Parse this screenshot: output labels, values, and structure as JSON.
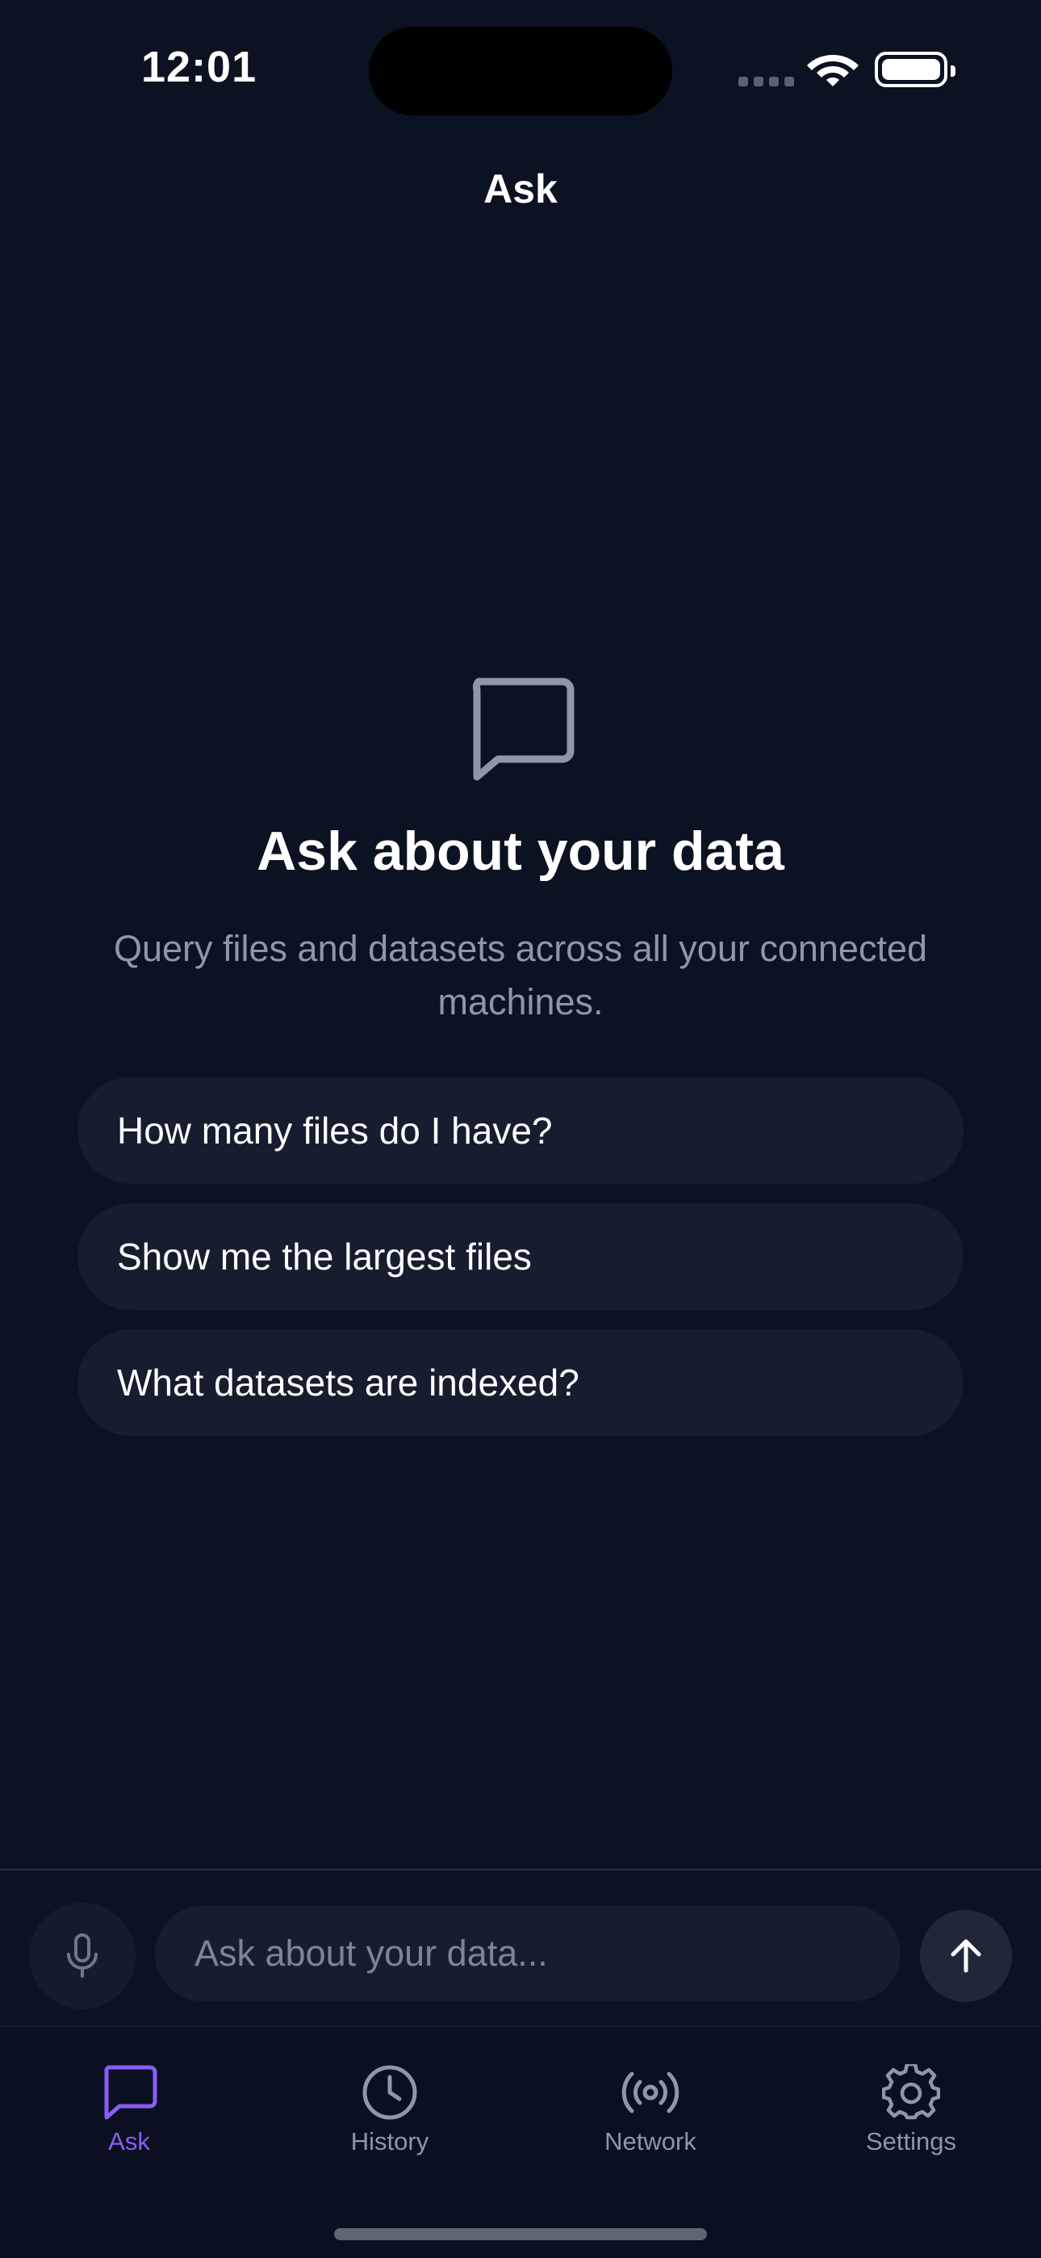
{
  "status_bar": {
    "time": "12:01"
  },
  "nav": {
    "title": "Ask"
  },
  "empty_state": {
    "icon": "chat-bubble-icon",
    "title": "Ask about your data",
    "subtitle": "Query files and datasets across all your connected machines."
  },
  "suggestions": [
    {
      "label": "How many files do I have?"
    },
    {
      "label": "Show me the largest files"
    },
    {
      "label": "What datasets are indexed?"
    }
  ],
  "composer": {
    "placeholder": "Ask about your data...",
    "mic_icon": "microphone-icon",
    "send_icon": "arrow-up-icon"
  },
  "tabs": [
    {
      "label": "Ask",
      "icon": "chat-bubble-icon",
      "active": true
    },
    {
      "label": "History",
      "icon": "clock-icon",
      "active": false
    },
    {
      "label": "Network",
      "icon": "broadcast-icon",
      "active": false
    },
    {
      "label": "Settings",
      "icon": "gear-icon",
      "active": false
    }
  ],
  "colors": {
    "background": "#0b1222",
    "accent": "#8b5cf6",
    "muted": "#8e97a8",
    "card": "#151d2e"
  }
}
